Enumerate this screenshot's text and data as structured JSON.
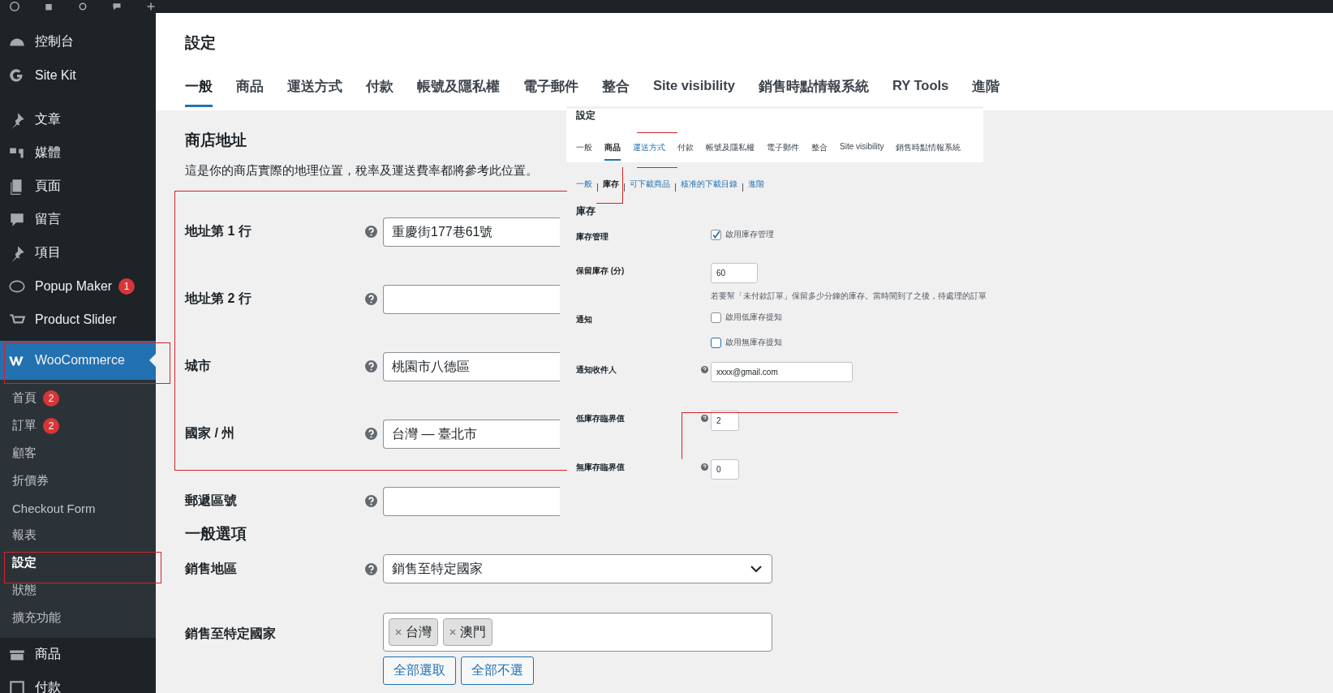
{
  "sidebar": {
    "items": [
      {
        "label": "控制台",
        "current": false
      },
      {
        "label": "Site Kit",
        "current": false
      },
      {
        "label": "文章",
        "current": false
      },
      {
        "label": "媒體",
        "current": false
      },
      {
        "label": "頁面",
        "current": false
      },
      {
        "label": "留言",
        "current": false
      },
      {
        "label": "項目",
        "current": false
      },
      {
        "label": "Popup Maker",
        "current": false,
        "badge": "1"
      },
      {
        "label": "Product Slider",
        "current": false
      },
      {
        "label": "WooCommerce",
        "current": true,
        "children": [
          {
            "label": "首頁",
            "selected": false,
            "badge": "2"
          },
          {
            "label": "訂單",
            "selected": false,
            "badge": "2"
          },
          {
            "label": "顧客",
            "selected": false
          },
          {
            "label": "折價券",
            "selected": false
          },
          {
            "label": "Checkout Form",
            "selected": false
          },
          {
            "label": "報表",
            "selected": false
          },
          {
            "label": "設定",
            "selected": true
          },
          {
            "label": "狀態",
            "selected": false
          },
          {
            "label": "擴充功能",
            "selected": false
          }
        ]
      },
      {
        "label": "商品",
        "current": false
      },
      {
        "label": "付款",
        "current": false
      }
    ]
  },
  "header": {
    "title": "設定",
    "tabs": [
      {
        "label": "一般",
        "selected": true
      },
      {
        "label": "商品",
        "selected": false
      },
      {
        "label": "運送方式",
        "selected": false
      },
      {
        "label": "付款",
        "selected": false
      },
      {
        "label": "帳號及隱私權",
        "selected": false
      },
      {
        "label": "電子郵件",
        "selected": false
      },
      {
        "label": "整合",
        "selected": false
      },
      {
        "label": "Site visibility",
        "selected": false
      },
      {
        "label": "銷售時點情報系統",
        "selected": false
      },
      {
        "label": "RY Tools",
        "selected": false
      },
      {
        "label": "進階",
        "selected": false
      }
    ]
  },
  "store_address": {
    "title": "商店地址",
    "description": "這是你的商店實際的地理位置，稅率及運送費率都將參考此位置。",
    "fields": [
      {
        "label": "地址第 1 行",
        "value": "重慶街177巷61號"
      },
      {
        "label": "地址第 2 行"
      },
      {
        "label": "城市",
        "value": "桃園市八德區"
      },
      {
        "label": "國家 / 州",
        "value": "台灣 — 臺北市"
      },
      {
        "label": "郵遞區號"
      }
    ]
  },
  "general_options": {
    "title": "一般選項",
    "selling_location": {
      "label": "銷售地區",
      "value": "銷售至特定國家"
    },
    "specific_countries": {
      "label": "銷售至特定國家",
      "tags": [
        "台灣",
        "澳門"
      ],
      "buttons": [
        "全部選取",
        "全部不選"
      ]
    }
  },
  "inset": {
    "title": "設定",
    "tabs": [
      {
        "label": "一般",
        "selected": false
      },
      {
        "label": "商品",
        "selected": true
      },
      {
        "label": "運送方式",
        "selected": false
      },
      {
        "label": "付款",
        "selected": false
      },
      {
        "label": "帳號及隱私權",
        "selected": false
      },
      {
        "label": "電子郵件",
        "selected": false
      },
      {
        "label": "整合",
        "selected": false
      },
      {
        "label": "Site visibility",
        "selected": false
      },
      {
        "label": "銷售時點情報系統",
        "selected": false
      }
    ],
    "subnav": [
      {
        "label": "一般",
        "selected": false
      },
      {
        "label": "庫存",
        "selected": true
      },
      {
        "label": "可下載商品",
        "selected": false
      },
      {
        "label": "核准的下載目錄",
        "selected": false
      },
      {
        "label": "進階",
        "selected": false
      }
    ],
    "section_title": "庫存",
    "rows": [
      {
        "kind": "checkbox",
        "label": "庫存管理",
        "text": "啟用庫存管理",
        "checked": true
      },
      {
        "kind": "number",
        "label": "保留庫存 (分)",
        "value": "60",
        "hint": "若要幫「未付款訂單」保留多少分鐘的庫存。當時間到了之後，待處理的訂單"
      },
      {
        "kind": "checkbox",
        "label": "通知",
        "text": "啟用低庫存提知",
        "checked": false
      },
      {
        "kind": "checkbox",
        "text": "啟用無庫存提知",
        "checked": false
      },
      {
        "kind": "email",
        "label": "通知收件人",
        "value": "xxxx@gmail.com"
      },
      {
        "kind": "number",
        "label": "低庫存臨界值",
        "value": "2"
      },
      {
        "kind": "number",
        "label": "無庫存臨界值",
        "value": "0"
      }
    ]
  }
}
